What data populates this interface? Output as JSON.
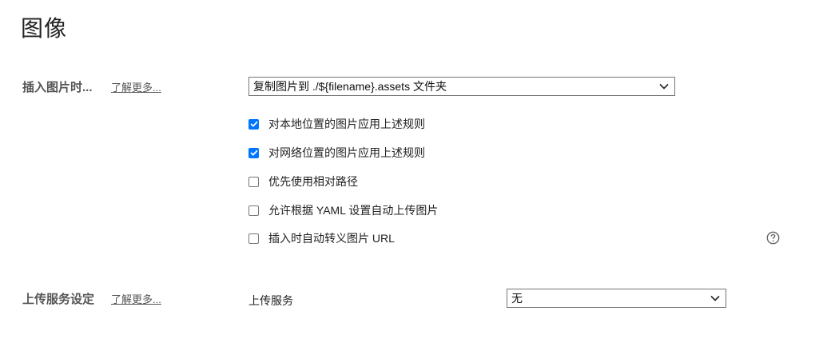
{
  "page": {
    "title": "图像"
  },
  "insert_section": {
    "label": "插入图片时...",
    "learn_more": "了解更多...",
    "action_select": {
      "value": "复制图片到 ./${filename}.assets 文件夹"
    },
    "options": [
      {
        "label": "对本地位置的图片应用上述规则",
        "checked": true
      },
      {
        "label": "对网络位置的图片应用上述规则",
        "checked": true
      },
      {
        "label": "优先使用相对路径",
        "checked": false
      },
      {
        "label": "允许根据 YAML 设置自动上传图片",
        "checked": false
      },
      {
        "label": "插入时自动转义图片 URL",
        "checked": false
      }
    ]
  },
  "upload_section": {
    "label": "上传服务设定",
    "learn_more": "了解更多...",
    "service_label": "上传服务",
    "service_select": {
      "value": "无"
    }
  },
  "icons": {
    "checkmark": "check-icon",
    "dropdown": "chevron-down-icon",
    "help": "question-circle-icon"
  },
  "colors": {
    "checkbox_checked": "#0075ff",
    "checkbox_border": "#767676",
    "select_border": "#767676"
  }
}
